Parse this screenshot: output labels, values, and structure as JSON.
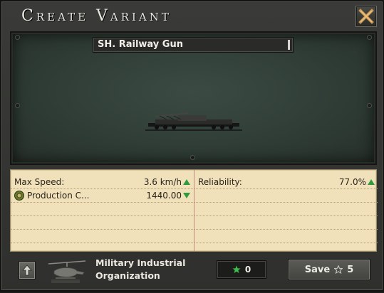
{
  "window": {
    "title": "Create Variant"
  },
  "preview": {
    "variant_name": "SH. Railway Gun"
  },
  "stats": {
    "left": [
      {
        "label": "Max Speed:",
        "value": "3.6 km/h",
        "trend": "up"
      },
      {
        "label": "Production C...",
        "value": "1440.00",
        "trend": "down"
      }
    ],
    "right": [
      {
        "label": "Reliability:",
        "value": "77.0%",
        "trend": "up"
      }
    ]
  },
  "footer": {
    "organization_name": "Military Industrial Organization",
    "experience": "0",
    "save_label": "Save",
    "save_cost": "5"
  },
  "colors": {
    "trend_green": "#2f9b3e",
    "star_green": "#3dbd4a",
    "stats_bg": "#f1e1bb"
  }
}
